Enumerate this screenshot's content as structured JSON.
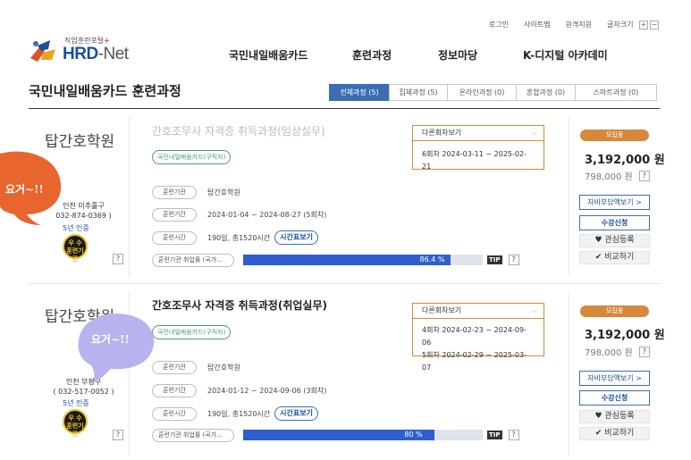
{
  "header": {
    "util_links": [
      "로그인",
      "사이트맵",
      "원격지원",
      "글자크기"
    ],
    "font_plus": "+",
    "font_minus": "−",
    "logo_sub_prefix": "직업훈련포털",
    "logo_sub_plus": "+",
    "logo_hrd": "HRD",
    "logo_net": "-Net",
    "nav": [
      "국민내일배움카드",
      "훈련과정",
      "정보마당",
      "K-디지털 아카데미"
    ]
  },
  "page": {
    "title": "국민내일배움카드 훈련과정",
    "tabs": [
      {
        "label": "전체과정 (5)",
        "active": true
      },
      {
        "label": "집체과정 (5)",
        "active": false
      },
      {
        "label": "온라인과정 (0)",
        "active": false
      },
      {
        "label": "혼합과정 (0)",
        "active": false
      },
      {
        "label": "스마트과정 (0)",
        "active": false
      }
    ]
  },
  "courses": [
    {
      "institution": "탑간호학원",
      "location_line1": "인천 미추홀구",
      "location_line2": "032-874-0369 )",
      "years": "5년 인증",
      "badge_line1": "우 수",
      "badge_line2": "훈련기관",
      "title": "간호조무사 자격증 취득과정(임상실무)",
      "tag": "국민내일배움카드(구직자)",
      "rows": [
        {
          "label": "훈련기관",
          "value": "탑간호학원"
        },
        {
          "label": "훈련기간",
          "value": "2024-01-04 ~ 2024-08-27 (5회차)"
        },
        {
          "label": "훈련시간",
          "value": "190일, 총1520시간",
          "button": "시간표보기"
        }
      ],
      "rate_label": "훈련기관 취업률 (국가...",
      "rate_value": 86.4,
      "rate_text": "86.4 %",
      "tip": "TIP",
      "help": "?",
      "session_header": "다른회차보기",
      "sessions": [
        "6회차 2024-03-11 ~ 2025-02-21"
      ],
      "status": "모집중",
      "price": "3,192,000 원",
      "orig_price": "798,000 원",
      "btn_self_pay": "자비부담액보기 >",
      "btn_apply": "수강신청",
      "btn_interest": "관심등록",
      "btn_compare": "비교하기"
    },
    {
      "institution": "탑간호학원",
      "location_line1": "인천 부평구",
      "location_line2": "( 032-517-0052 )",
      "years": "5년 인증",
      "badge_line1": "우 수",
      "badge_line2": "훈련기관",
      "title": "간호조무사 자격증 취득과정(취업실무)",
      "tag": "국민내일배움카드(구직자)",
      "rows": [
        {
          "label": "훈련기관",
          "value": "탑간호학원"
        },
        {
          "label": "훈련기간",
          "value": "2024-01-12 ~ 2024-09-06 (3회차)"
        },
        {
          "label": "훈련시간",
          "value": "190일, 총1520시간",
          "button": "시간표보기"
        }
      ],
      "rate_label": "훈련기관 취업률 (국가...",
      "rate_value": 80,
      "rate_text": "80 %",
      "tip": "TIP",
      "help": "?",
      "session_header": "다른회차보기",
      "sessions": [
        "4회차 2024-02-23 ~ 2024-09-06",
        "5회차 2024-02-29 ~ 2025-03-07"
      ],
      "status": "모집중",
      "price": "3,192,000 원",
      "orig_price": "798,000 원",
      "btn_self_pay": "자비부담액보기 >",
      "btn_apply": "수강신청",
      "btn_interest": "관심등록",
      "btn_compare": "비교하기"
    }
  ],
  "annotations": {
    "bubble_1": "요거~!!",
    "bubble_1_color": "#e8652f",
    "bubble_2": "요거~!!",
    "bubble_2_color": "#b7b3ee"
  },
  "colors": {
    "accent_blue": "#3b6db3",
    "bar_fill": "#2f5fcc",
    "recruit_orange": "#d48a3a",
    "session_border": "#d08c3a",
    "tag_green": "#4a9b7a"
  },
  "icons": {
    "chevron": "chevron-down-icon",
    "heart": "heart-icon",
    "check": "check-icon"
  }
}
